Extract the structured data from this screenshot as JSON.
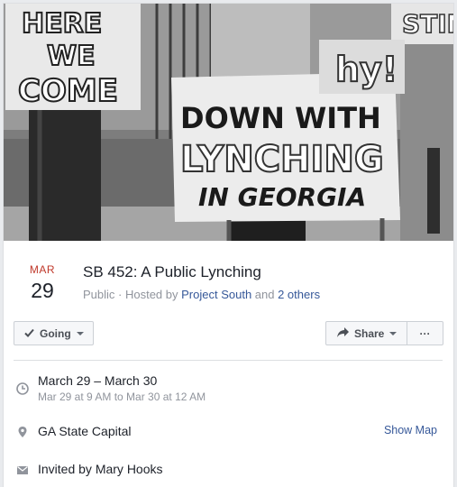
{
  "cover": {
    "sign_left_lines": [
      "HERE",
      "WE",
      "COME"
    ],
    "sign_center_lines": [
      "DOWN WITH",
      "LYNCHING",
      "IN GEORGIA"
    ],
    "sign_right_top": "STIN",
    "sign_right_mid": "hy!"
  },
  "event": {
    "month": "MAR",
    "day": "29",
    "title": "SB 452: A Public Lynching",
    "privacy": "Public",
    "hosted_prefix": " · Hosted by ",
    "host": "Project South",
    "and": " and ",
    "others": "2 others"
  },
  "actions": {
    "going_label": "Going",
    "share_label": "Share",
    "more_label": "···"
  },
  "details": {
    "date_range": "March 29 – March 30",
    "time_range": "Mar 29 at 9 AM to Mar 30 at 12 AM",
    "location": "GA State Capital",
    "show_map": "Show Map",
    "invited_by": "Invited by Mary Hooks"
  }
}
